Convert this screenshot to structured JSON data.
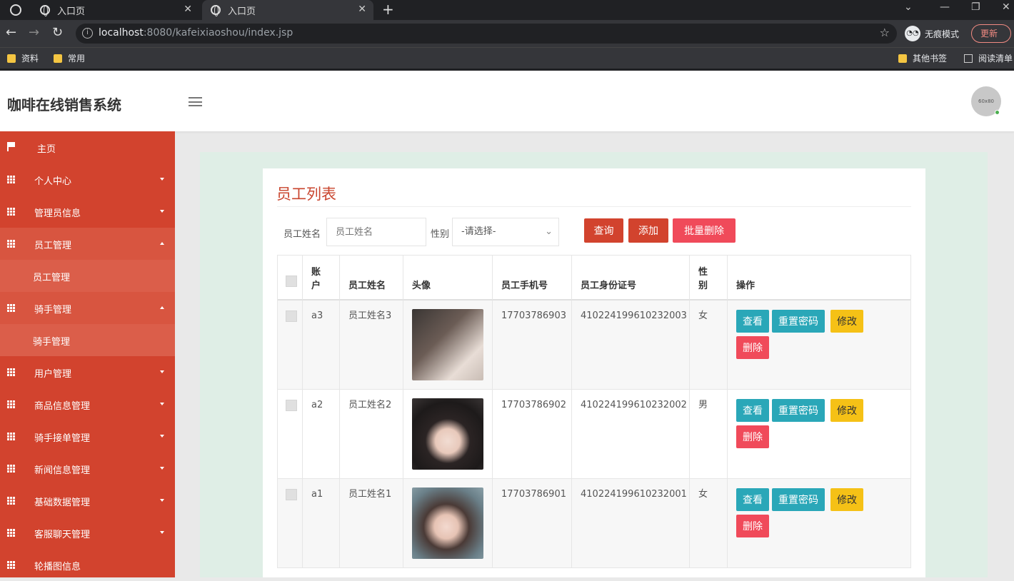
{
  "browser": {
    "tabs": [
      {
        "title": "入口页"
      },
      {
        "title": "入口页"
      }
    ],
    "url_host": "localhost",
    "url_rest": ":8080/kafeixiaoshou/index.jsp",
    "incognito_label": "无痕模式",
    "update_label": "更新",
    "bookmarks": [
      "资料",
      "常用"
    ],
    "other_bookmarks": "其他书签",
    "reading_list": "阅读清单"
  },
  "header": {
    "brand": "咖啡在线销售系统",
    "avatar_text": "60x80"
  },
  "sidebar": {
    "items": [
      {
        "label": "主页",
        "icon": "flag-icon"
      },
      {
        "label": "个人中心",
        "icon": "grid-icon"
      },
      {
        "label": "管理员信息",
        "icon": "grid-icon"
      },
      {
        "label": "员工管理",
        "icon": "grid-icon",
        "expanded": true
      },
      {
        "label": "员工管理",
        "sub": true
      },
      {
        "label": "骑手管理",
        "icon": "grid-icon",
        "expanded": true
      },
      {
        "label": "骑手管理",
        "sub": true
      },
      {
        "label": "用户管理",
        "icon": "grid-icon"
      },
      {
        "label": "商品信息管理",
        "icon": "grid-icon"
      },
      {
        "label": "骑手接单管理",
        "icon": "grid-icon"
      },
      {
        "label": "新闻信息管理",
        "icon": "grid-icon"
      },
      {
        "label": "基础数据管理",
        "icon": "grid-icon"
      },
      {
        "label": "客服聊天管理",
        "icon": "grid-icon"
      },
      {
        "label": "轮播图信息",
        "icon": "grid-icon"
      }
    ]
  },
  "page": {
    "title": "员工列表",
    "search": {
      "name_label": "员工姓名",
      "name_placeholder": "员工姓名",
      "gender_label": "性别",
      "gender_value": "-请选择-",
      "query_button": "查询",
      "add_button": "添加",
      "batch_delete_button": "批量删除"
    },
    "table": {
      "headers": [
        "账户",
        "员工姓名",
        "头像",
        "员工手机号",
        "员工身份证号",
        "性别",
        "操作"
      ],
      "rows": [
        {
          "account": "a3",
          "name": "员工姓名3",
          "phone": "17703786903",
          "id_card": "410224199610232003",
          "gender": "女"
        },
        {
          "account": "a2",
          "name": "员工姓名2",
          "phone": "17703786902",
          "id_card": "410224199610232002",
          "gender": "男"
        },
        {
          "account": "a1",
          "name": "员工姓名1",
          "phone": "17703786901",
          "id_card": "410224199610232001",
          "gender": "女"
        }
      ],
      "actions": {
        "view": "查看",
        "reset_password": "重置密码",
        "edit": "修改",
        "delete": "删除"
      }
    }
  },
  "colors": {
    "sidebar": "#d2432e",
    "accent": "#c9452e",
    "view": "#2aa7b8",
    "edit": "#f5c116",
    "delete": "#f04a5a"
  }
}
